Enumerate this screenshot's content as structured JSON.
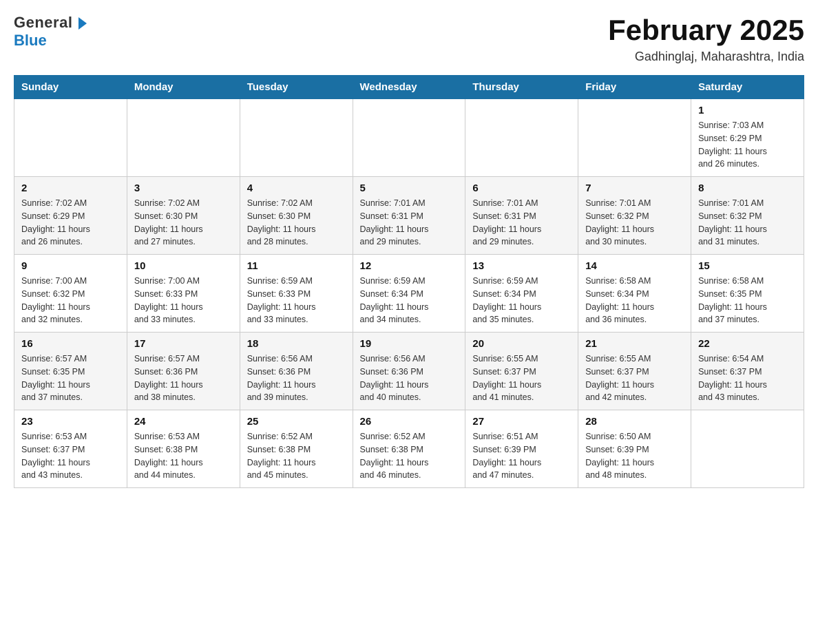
{
  "header": {
    "logo": {
      "general": "General",
      "blue": "Blue"
    },
    "title": "February 2025",
    "location": "Gadhinglaj, Maharashtra, India"
  },
  "calendar": {
    "days_of_week": [
      "Sunday",
      "Monday",
      "Tuesday",
      "Wednesday",
      "Thursday",
      "Friday",
      "Saturday"
    ],
    "weeks": [
      [
        {
          "day": "",
          "info": ""
        },
        {
          "day": "",
          "info": ""
        },
        {
          "day": "",
          "info": ""
        },
        {
          "day": "",
          "info": ""
        },
        {
          "day": "",
          "info": ""
        },
        {
          "day": "",
          "info": ""
        },
        {
          "day": "1",
          "info": "Sunrise: 7:03 AM\nSunset: 6:29 PM\nDaylight: 11 hours\nand 26 minutes."
        }
      ],
      [
        {
          "day": "2",
          "info": "Sunrise: 7:02 AM\nSunset: 6:29 PM\nDaylight: 11 hours\nand 26 minutes."
        },
        {
          "day": "3",
          "info": "Sunrise: 7:02 AM\nSunset: 6:30 PM\nDaylight: 11 hours\nand 27 minutes."
        },
        {
          "day": "4",
          "info": "Sunrise: 7:02 AM\nSunset: 6:30 PM\nDaylight: 11 hours\nand 28 minutes."
        },
        {
          "day": "5",
          "info": "Sunrise: 7:01 AM\nSunset: 6:31 PM\nDaylight: 11 hours\nand 29 minutes."
        },
        {
          "day": "6",
          "info": "Sunrise: 7:01 AM\nSunset: 6:31 PM\nDaylight: 11 hours\nand 29 minutes."
        },
        {
          "day": "7",
          "info": "Sunrise: 7:01 AM\nSunset: 6:32 PM\nDaylight: 11 hours\nand 30 minutes."
        },
        {
          "day": "8",
          "info": "Sunrise: 7:01 AM\nSunset: 6:32 PM\nDaylight: 11 hours\nand 31 minutes."
        }
      ],
      [
        {
          "day": "9",
          "info": "Sunrise: 7:00 AM\nSunset: 6:32 PM\nDaylight: 11 hours\nand 32 minutes."
        },
        {
          "day": "10",
          "info": "Sunrise: 7:00 AM\nSunset: 6:33 PM\nDaylight: 11 hours\nand 33 minutes."
        },
        {
          "day": "11",
          "info": "Sunrise: 6:59 AM\nSunset: 6:33 PM\nDaylight: 11 hours\nand 33 minutes."
        },
        {
          "day": "12",
          "info": "Sunrise: 6:59 AM\nSunset: 6:34 PM\nDaylight: 11 hours\nand 34 minutes."
        },
        {
          "day": "13",
          "info": "Sunrise: 6:59 AM\nSunset: 6:34 PM\nDaylight: 11 hours\nand 35 minutes."
        },
        {
          "day": "14",
          "info": "Sunrise: 6:58 AM\nSunset: 6:34 PM\nDaylight: 11 hours\nand 36 minutes."
        },
        {
          "day": "15",
          "info": "Sunrise: 6:58 AM\nSunset: 6:35 PM\nDaylight: 11 hours\nand 37 minutes."
        }
      ],
      [
        {
          "day": "16",
          "info": "Sunrise: 6:57 AM\nSunset: 6:35 PM\nDaylight: 11 hours\nand 37 minutes."
        },
        {
          "day": "17",
          "info": "Sunrise: 6:57 AM\nSunset: 6:36 PM\nDaylight: 11 hours\nand 38 minutes."
        },
        {
          "day": "18",
          "info": "Sunrise: 6:56 AM\nSunset: 6:36 PM\nDaylight: 11 hours\nand 39 minutes."
        },
        {
          "day": "19",
          "info": "Sunrise: 6:56 AM\nSunset: 6:36 PM\nDaylight: 11 hours\nand 40 minutes."
        },
        {
          "day": "20",
          "info": "Sunrise: 6:55 AM\nSunset: 6:37 PM\nDaylight: 11 hours\nand 41 minutes."
        },
        {
          "day": "21",
          "info": "Sunrise: 6:55 AM\nSunset: 6:37 PM\nDaylight: 11 hours\nand 42 minutes."
        },
        {
          "day": "22",
          "info": "Sunrise: 6:54 AM\nSunset: 6:37 PM\nDaylight: 11 hours\nand 43 minutes."
        }
      ],
      [
        {
          "day": "23",
          "info": "Sunrise: 6:53 AM\nSunset: 6:37 PM\nDaylight: 11 hours\nand 43 minutes."
        },
        {
          "day": "24",
          "info": "Sunrise: 6:53 AM\nSunset: 6:38 PM\nDaylight: 11 hours\nand 44 minutes."
        },
        {
          "day": "25",
          "info": "Sunrise: 6:52 AM\nSunset: 6:38 PM\nDaylight: 11 hours\nand 45 minutes."
        },
        {
          "day": "26",
          "info": "Sunrise: 6:52 AM\nSunset: 6:38 PM\nDaylight: 11 hours\nand 46 minutes."
        },
        {
          "day": "27",
          "info": "Sunrise: 6:51 AM\nSunset: 6:39 PM\nDaylight: 11 hours\nand 47 minutes."
        },
        {
          "day": "28",
          "info": "Sunrise: 6:50 AM\nSunset: 6:39 PM\nDaylight: 11 hours\nand 48 minutes."
        },
        {
          "day": "",
          "info": ""
        }
      ]
    ]
  }
}
